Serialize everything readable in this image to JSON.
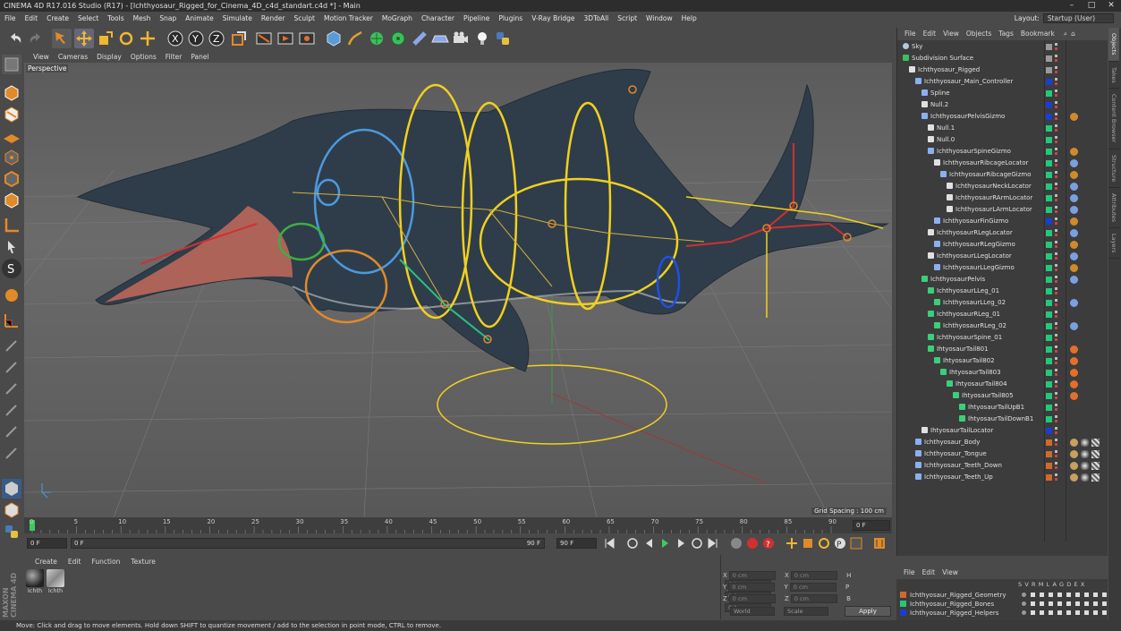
{
  "window": {
    "title": "CINEMA 4D R17.016 Studio (R17) - [Ichthyosaur_Rigged_for_Cinema_4D_c4d_standart.c4d *] - Main",
    "controls": [
      "–",
      "□",
      "✕"
    ]
  },
  "menubar": {
    "items": [
      "File",
      "Edit",
      "Create",
      "Select",
      "Tools",
      "Mesh",
      "Snap",
      "Animate",
      "Simulate",
      "Render",
      "Sculpt",
      "Motion Tracker",
      "MoGraph",
      "Character",
      "Pipeline",
      "Plugins",
      "V-Ray Bridge",
      "3DToAll",
      "Script",
      "Window",
      "Help"
    ],
    "layout_label": "Layout:",
    "layout_value": "Startup (User)"
  },
  "viewport": {
    "menu": [
      "View",
      "Cameras",
      "Display",
      "Options",
      "Filter",
      "Panel"
    ],
    "label": "Perspective",
    "grid_spacing": "Grid Spacing : 100 cm"
  },
  "timeline": {
    "ticks": [
      "0",
      "5",
      "10",
      "15",
      "20",
      "25",
      "30",
      "35",
      "40",
      "45",
      "50",
      "55",
      "60",
      "65",
      "70",
      "75",
      "80",
      "85",
      "90"
    ],
    "end_field": "0 F",
    "start_field": "0 F",
    "min_field": "0 F",
    "slider_end": "90 F",
    "max_field": "90 F"
  },
  "materials": {
    "menu": [
      "Create",
      "Edit",
      "Function",
      "Texture"
    ],
    "items": [
      {
        "name": "Ichth"
      },
      {
        "name": "Ichth"
      }
    ]
  },
  "coordinates": {
    "rows": [
      {
        "a": "X",
        "av": "0 cm",
        "b": "X",
        "bv": "0 cm",
        "c": "H",
        "cv": "0 °"
      },
      {
        "a": "Y",
        "av": "0 cm",
        "b": "Y",
        "bv": "0 cm",
        "c": "P",
        "cv": "0 °"
      },
      {
        "a": "Z",
        "av": "0 cm",
        "b": "Z",
        "bv": "0 cm",
        "c": "B",
        "cv": "0 °"
      }
    ],
    "mode": "World",
    "scale": "Scale",
    "apply": "Apply"
  },
  "object_manager": {
    "menu": [
      "File",
      "Edit",
      "View",
      "Objects",
      "Tags",
      "Bookmark"
    ],
    "objects": [
      {
        "name": "Sky",
        "depth": 0,
        "color": "#9a9a9a",
        "icon": "sky-icon",
        "tag": ""
      },
      {
        "name": "Subdivision Surface",
        "depth": 0,
        "color": "#9a9a9a",
        "icon": "subdivision-icon",
        "tag": ""
      },
      {
        "name": "Ichthyosaur_Rigged",
        "depth": 1,
        "color": "#9a9a9a",
        "icon": "null-icon",
        "tag": ""
      },
      {
        "name": "Ichthyosaur_Main_Controller",
        "depth": 2,
        "color": "#1a3fd0",
        "icon": "spline-icon",
        "tag": ""
      },
      {
        "name": "Spline",
        "depth": 3,
        "color": "#22c97a",
        "icon": "spline-icon",
        "tag": ""
      },
      {
        "name": "Null.2",
        "depth": 3,
        "color": "#1a3fd0",
        "icon": "null-icon",
        "tag": ""
      },
      {
        "name": "IchthyosaurPelvisGizmo",
        "depth": 3,
        "color": "#1a3fd0",
        "icon": "gizmo-icon",
        "tag": "#d08a2a"
      },
      {
        "name": "Null.1",
        "depth": 4,
        "color": "#22c97a",
        "icon": "null-icon",
        "tag": ""
      },
      {
        "name": "Null.0",
        "depth": 4,
        "color": "#22c97a",
        "icon": "null-icon",
        "tag": ""
      },
      {
        "name": "IchthyosaurSpineGizmo",
        "depth": 4,
        "color": "#22c97a",
        "icon": "gizmo-icon",
        "tag": "#d08a2a"
      },
      {
        "name": "IchthyosaurRibcageLocator",
        "depth": 5,
        "color": "#22c97a",
        "icon": "null-icon",
        "tag": "#7aa0e0"
      },
      {
        "name": "IchthyosaurRibcageGizmo",
        "depth": 6,
        "color": "#22c97a",
        "icon": "gizmo-icon",
        "tag": "#d08a2a"
      },
      {
        "name": "IchthyosaurNeckLocator",
        "depth": 7,
        "color": "#22c97a",
        "icon": "null-icon",
        "tag": "#7aa0e0"
      },
      {
        "name": "IchthyosaurRArmLocator",
        "depth": 7,
        "color": "#22c97a",
        "icon": "null-icon",
        "tag": "#7aa0e0"
      },
      {
        "name": "IchthyosaurLArmLocator",
        "depth": 7,
        "color": "#22c97a",
        "icon": "null-icon",
        "tag": "#7aa0e0"
      },
      {
        "name": "IchthyosaurFinGizmo",
        "depth": 5,
        "color": "#1a3fd0",
        "icon": "gizmo-icon",
        "tag": "#d08a2a"
      },
      {
        "name": "IchthyosaurRLegLocator",
        "depth": 4,
        "color": "#22c97a",
        "icon": "null-icon",
        "tag": "#7aa0e0"
      },
      {
        "name": "IchthyosaurRLegGizmo",
        "depth": 5,
        "color": "#22c97a",
        "icon": "gizmo-icon",
        "tag": "#d08a2a"
      },
      {
        "name": "IchthyosaurLLegLocator",
        "depth": 4,
        "color": "#22c97a",
        "icon": "null-icon",
        "tag": "#7aa0e0"
      },
      {
        "name": "IchthyosaurLLegGizmo",
        "depth": 5,
        "color": "#22c97a",
        "icon": "gizmo-icon",
        "tag": "#d08a2a"
      },
      {
        "name": "IchthyosaurPelvis",
        "depth": 3,
        "color": "#22c97a",
        "icon": "bone-icon",
        "tag": "#7aa0e0"
      },
      {
        "name": "IchthyosaurLLeg_01",
        "depth": 4,
        "color": "#22c97a",
        "icon": "bone-icon",
        "tag": ""
      },
      {
        "name": "IchthyosaurLLeg_02",
        "depth": 5,
        "color": "#22c97a",
        "icon": "bone-icon",
        "tag": "#7aa0e0"
      },
      {
        "name": "IchthyosaurRLeg_01",
        "depth": 4,
        "color": "#22c97a",
        "icon": "bone-icon",
        "tag": ""
      },
      {
        "name": "IchthyosaurRLeg_02",
        "depth": 5,
        "color": "#22c97a",
        "icon": "bone-icon",
        "tag": "#7aa0e0"
      },
      {
        "name": "IchthyosaurSpine_01",
        "depth": 4,
        "color": "#22c97a",
        "icon": "bone-icon",
        "tag": ""
      },
      {
        "name": "IhtyosaurTail801",
        "depth": 4,
        "color": "#22c97a",
        "icon": "bone-icon",
        "tag": "#e0702a"
      },
      {
        "name": "IhtyosaurTail802",
        "depth": 5,
        "color": "#22c97a",
        "icon": "bone-icon",
        "tag": "#e0702a"
      },
      {
        "name": "IhtyosaurTail803",
        "depth": 6,
        "color": "#22c97a",
        "icon": "bone-icon",
        "tag": "#e0702a"
      },
      {
        "name": "IhtyosaurTail804",
        "depth": 7,
        "color": "#22c97a",
        "icon": "bone-icon",
        "tag": "#e0702a"
      },
      {
        "name": "IhtyosaurTail805",
        "depth": 8,
        "color": "#22c97a",
        "icon": "bone-icon",
        "tag": "#e0702a"
      },
      {
        "name": "IhtyosaurTailUpB1",
        "depth": 9,
        "color": "#22c97a",
        "icon": "bone-icon",
        "tag": ""
      },
      {
        "name": "IhtyosaurTailDownB1",
        "depth": 9,
        "color": "#22c97a",
        "icon": "bone-icon",
        "tag": ""
      },
      {
        "name": "IhtyosaurTailLocator",
        "depth": 3,
        "color": "#1a3fd0",
        "icon": "null-icon",
        "tag": ""
      },
      {
        "name": "Ichthyosaur_Body",
        "depth": 2,
        "color": "#d06a2a",
        "icon": "mesh-icon",
        "tag": "#c8a060"
      },
      {
        "name": "Ichthyosaur_Tongue",
        "depth": 2,
        "color": "#d06a2a",
        "icon": "mesh-icon",
        "tag": "#c8a060"
      },
      {
        "name": "Ichthyosaur_Teeth_Down",
        "depth": 2,
        "color": "#d06a2a",
        "icon": "mesh-icon",
        "tag": "#c8a060"
      },
      {
        "name": "Ichthyosaur_Teeth_Up",
        "depth": 2,
        "color": "#d06a2a",
        "icon": "mesh-icon",
        "tag": "#c8a060"
      }
    ]
  },
  "layer_manager": {
    "menu": [
      "File",
      "Edit",
      "View"
    ],
    "headers": [
      "S",
      "V",
      "R",
      "M",
      "L",
      "A",
      "G",
      "D",
      "E",
      "X"
    ],
    "layers": [
      {
        "name": "Ichthyosaur_Rigged_Geometry",
        "color": "#d06a2a"
      },
      {
        "name": "Ichthyosaur_Rigged_Bones",
        "color": "#22c97a"
      },
      {
        "name": "Ichthyosaur_Rigged_Helpers",
        "color": "#1a3fd0"
      }
    ]
  },
  "side_tabs": [
    "Objects",
    "Takes",
    "Content Browser",
    "Structure",
    "Attributes",
    "Layers"
  ],
  "status": "Move: Click and drag to move elements. Hold down SHIFT to quantize movement / add to the selection in point mode, CTRL to remove.",
  "brand": "MAXON CINEMA 4D"
}
